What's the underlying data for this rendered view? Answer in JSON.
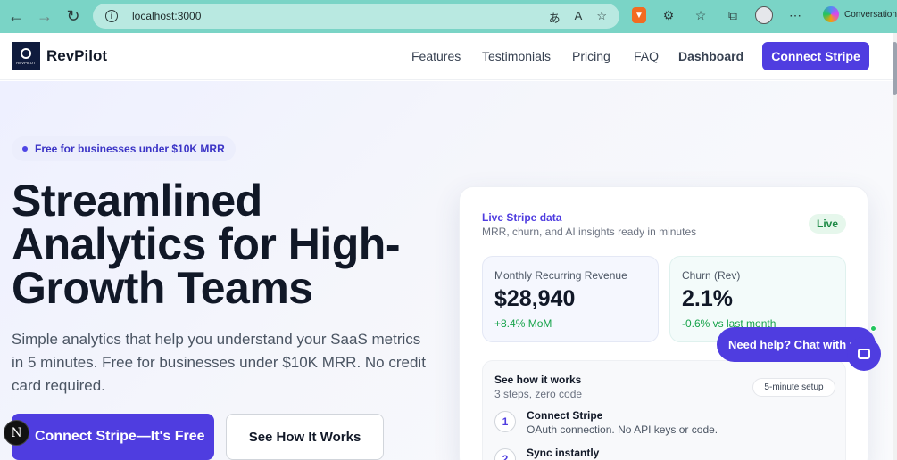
{
  "browser": {
    "url": "localhost:3000",
    "copilot_label": "Conversation"
  },
  "header": {
    "brand_name": "RevPilot",
    "brand_mark_text": "REVPILOT",
    "nav": [
      "Features",
      "Testimonials",
      "Pricing",
      "FAQ",
      "Dashboard"
    ],
    "cta": "Connect Stripe"
  },
  "hero": {
    "badge": "Free for businesses under $10K MRR",
    "headline": "Streamlined Analytics for High-Growth Teams",
    "subtext": "Simple analytics that help you understand your SaaS metrics in 5 minutes. Free for businesses under $10K MRR. No credit card required.",
    "primary_cta": "Connect Stripe—It's Free",
    "secondary_cta": "See How It Works",
    "n_badge": "N"
  },
  "card": {
    "title": "Live Stripe data",
    "subtitle": "MRR, churn, and AI insights ready in minutes",
    "live": "Live",
    "mrr": {
      "label": "Monthly Recurring Revenue",
      "value": "$28,940",
      "delta": "+8.4% MoM"
    },
    "churn": {
      "label": "Churn (Rev)",
      "value": "2.1%",
      "delta": "-0.6% vs last month"
    },
    "how": {
      "title": "See how it works",
      "subtitle": "3 steps, zero code",
      "pill": "5-minute setup",
      "steps": [
        {
          "num": "1",
          "title": "Connect Stripe",
          "desc": "OAuth connection. No API keys or code."
        },
        {
          "num": "2",
          "title": "Sync instantly",
          "desc": ""
        }
      ]
    }
  },
  "chat": {
    "label": "Need help? Chat with us"
  },
  "colors": {
    "accent": "#4f3de0",
    "browser_bar": "#7ad4c6",
    "positive": "#16a34a"
  }
}
